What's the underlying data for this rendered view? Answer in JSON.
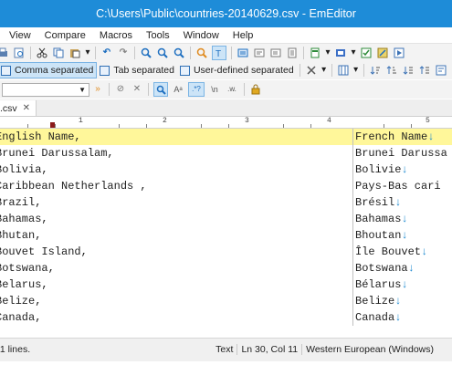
{
  "window": {
    "title": "C:\\Users\\Public\\countries-20140629.csv - EmEditor"
  },
  "menu": [
    "View",
    "Compare",
    "Macros",
    "Tools",
    "Window",
    "Help"
  ],
  "csv_bar": {
    "comma": "Comma separated",
    "tab": "Tab separated",
    "user": "User-defined separated"
  },
  "find_bar": {
    "regex_icon": ".*?",
    "newline_icon": "\\n",
    "word_icon": ".w."
  },
  "tab": {
    "name": ".csv"
  },
  "ruler": {
    "labels": [
      "1",
      "2",
      "3",
      "4",
      "5",
      "1"
    ]
  },
  "editor": {
    "rows": [
      {
        "c1": "English Name,",
        "c2": "French Name",
        "nl": "↓"
      },
      {
        "c1": "Brunei Darussalam,",
        "c2": "Brunei Darussa",
        "nl": ""
      },
      {
        "c1": "Bolivia,",
        "c2": "Bolivie",
        "nl": "↓"
      },
      {
        "c1": "Caribbean Netherlands ,",
        "c2": "Pays-Bas cari",
        "nl": ""
      },
      {
        "c1": "Brazil,",
        "c2": "Brésil",
        "nl": "↓"
      },
      {
        "c1": "Bahamas,",
        "c2": "Bahamas",
        "nl": "↓"
      },
      {
        "c1": "Bhutan,",
        "c2": "Bhoutan",
        "nl": "↓"
      },
      {
        "c1": "Bouvet Island,",
        "c2": "Île Bouvet",
        "nl": "↓"
      },
      {
        "c1": "Botswana,",
        "c2": "Botswana",
        "nl": "↓"
      },
      {
        "c1": "Belarus,",
        "c2": "Bélarus",
        "nl": "↓"
      },
      {
        "c1": "Belize,",
        "c2": "Belize",
        "nl": "↓"
      },
      {
        "c1": "Canada,",
        "c2": "Canada",
        "nl": "↓"
      }
    ]
  },
  "status": {
    "lines": "61 lines.",
    "mode": "Text",
    "position": "Ln 30, Col 11",
    "encoding": "Western European (Windows)"
  },
  "colors": {
    "titlebar": "#1e8cd8",
    "selected_row": "#fff79a",
    "newline_mark": "#1e8ad0",
    "ruler_mark": "#8b1a1a"
  }
}
